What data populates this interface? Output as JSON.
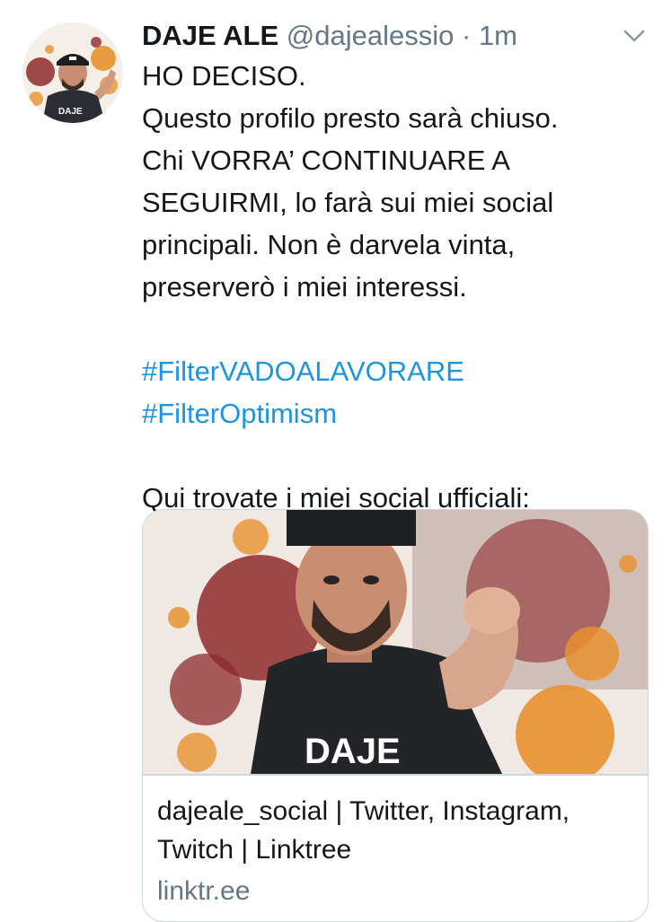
{
  "tweet": {
    "display_name": "DAJE ALE",
    "handle": "@dajealessio",
    "separator": "·",
    "time": "1m",
    "lines": [
      "HO DECISO.",
      "Questo profilo presto sarà chiuso.",
      "Chi VORRA’ CONTINUARE A",
      "SEGUIRMI, lo farà sui miei social",
      "principali. Non è darvela vinta,",
      "preserverò i miei interessi."
    ],
    "hashtags": [
      "#FilterVADOALAVORARE",
      "#FilterOptimism"
    ],
    "footer_line": "Qui trovate i miei social ufficiali:"
  },
  "card": {
    "title": "dajeale_social | Twitter, Instagram, Twitch | Linktree",
    "domain": "linktr.ee",
    "image_text": "DAJE"
  },
  "avatar": {
    "shirt_text": "DAJE"
  },
  "icons": {
    "menu": "chevron-down-icon"
  },
  "colors": {
    "text": "#14171a",
    "secondary": "#657786",
    "link": "#1b95e0",
    "border": "#ccd6dd"
  }
}
